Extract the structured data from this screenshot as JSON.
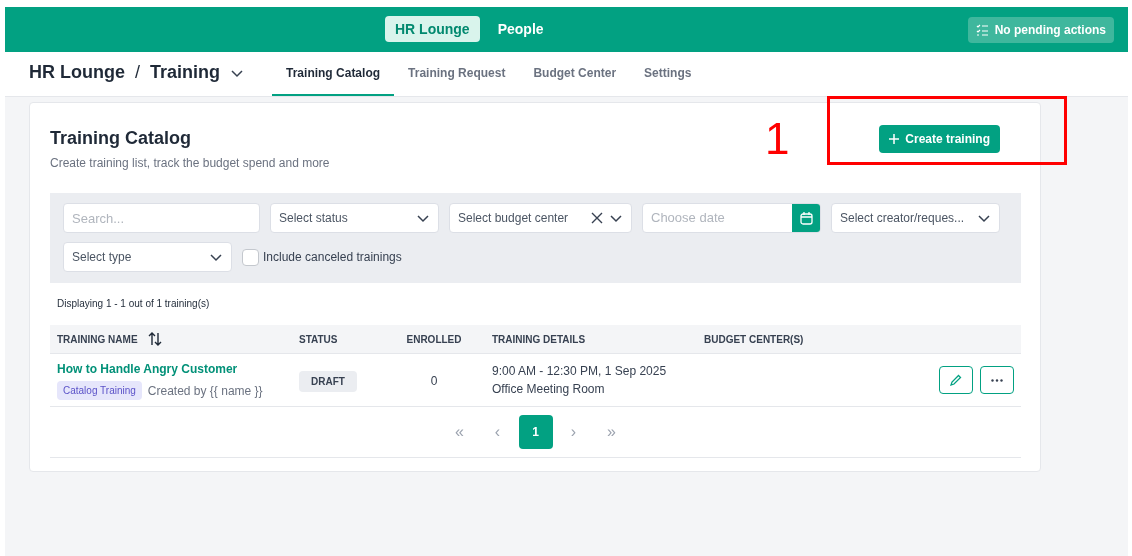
{
  "top_nav": {
    "items": [
      {
        "label": "HR Lounge",
        "selected": true
      },
      {
        "label": "People",
        "selected": false
      }
    ],
    "actions_button": "No pending actions"
  },
  "breadcrumb": {
    "root": "HR Lounge",
    "separator": "/",
    "current": "Training"
  },
  "tabs": [
    {
      "label": "Training Catalog",
      "selected": true
    },
    {
      "label": "Training Request",
      "selected": false
    },
    {
      "label": "Budget Center",
      "selected": false
    },
    {
      "label": "Settings",
      "selected": false
    }
  ],
  "card": {
    "title": "Training Catalog",
    "subtitle": "Create training list, track the budget spend and more",
    "create_button": "Create training"
  },
  "annotation": {
    "label": "1"
  },
  "filters": {
    "search": {
      "placeholder": "Search..."
    },
    "status": {
      "placeholder": "Select status"
    },
    "budget_center": {
      "placeholder": "Select budget center"
    },
    "date": {
      "placeholder": "Choose date"
    },
    "creator": {
      "placeholder": "Select creator/reques..."
    },
    "type": {
      "placeholder": "Select type"
    },
    "include_canceled": {
      "label": "Include canceled trainings",
      "checked": false
    }
  },
  "summary": "Displaying 1 - 1 out of 1 training(s)",
  "table": {
    "columns": [
      "TRAINING NAME",
      "STATUS",
      "ENROLLED",
      "TRAINING DETAILS",
      "BUDGET CENTER(S)"
    ],
    "rows": [
      {
        "name": "How to Handle Angry Customer",
        "tag": "Catalog Training",
        "created_by": "Created by {{ name }}",
        "status": "DRAFT",
        "enrolled": "0",
        "time": "9:00 AM - 12:30 PM, 1 Sep 2025",
        "location": "Office Meeting Room"
      }
    ]
  },
  "pagination": {
    "first": "«",
    "prev": "‹",
    "pages": [
      {
        "label": "1",
        "selected": true
      }
    ],
    "next": "›",
    "last": "»"
  }
}
